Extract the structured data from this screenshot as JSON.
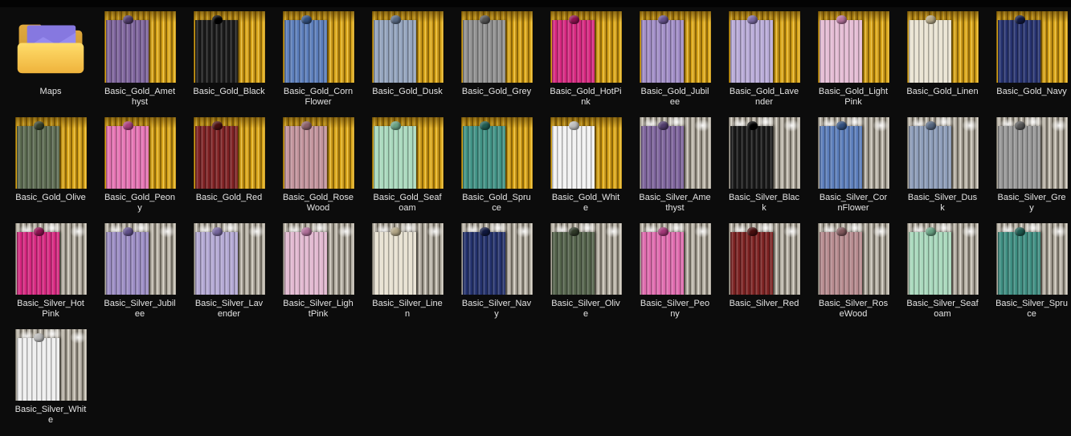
{
  "explorer": {
    "background": "#0c0c0c",
    "text_color": "#e4e4e4",
    "view": "large-icons-grid"
  },
  "folder": {
    "label": "Maps",
    "icon": "folder-with-map-icon",
    "folder_front_color": "#ffd75e",
    "folder_back_color": "#d99c2e",
    "map_color": "#8678e0"
  },
  "curtain_palette": {
    "gold_base": "#c8961a",
    "gold_light": "#f2cd55",
    "gold_dark": "#8a6508",
    "silver_base": "#aba599",
    "silver_light": "#e2ddd3",
    "silver_dark": "#6b665c"
  },
  "items": [
    {
      "label": "Basic_Gold_Amethyst",
      "curtain": "gold",
      "drape": "#7d639c",
      "accent": "#503c6b"
    },
    {
      "label": "Basic_Gold_Black",
      "curtain": "gold",
      "drape": "#191919",
      "accent": "#000000"
    },
    {
      "label": "Basic_Gold_CornFlower",
      "curtain": "gold",
      "drape": "#5a7cba",
      "accent": "#33517f"
    },
    {
      "label": "Basic_Gold_Dusk",
      "curtain": "gold",
      "drape": "#93a3bd",
      "accent": "#5a6b85"
    },
    {
      "label": "Basic_Gold_Grey",
      "curtain": "gold",
      "drape": "#909090",
      "accent": "#545454"
    },
    {
      "label": "Basic_Gold_HotPink",
      "curtain": "gold",
      "drape": "#d6267f",
      "accent": "#8e1251"
    },
    {
      "label": "Basic_Gold_Jubilee",
      "curtain": "gold",
      "drape": "#a18dc7",
      "accent": "#67538e"
    },
    {
      "label": "Basic_Gold_Lavender",
      "curtain": "gold",
      "drape": "#b9abd8",
      "accent": "#7c6ba3"
    },
    {
      "label": "Basic_Gold_LightPink",
      "curtain": "gold",
      "drape": "#e5bcd4",
      "accent": "#b5749e"
    },
    {
      "label": "Basic_Gold_Linen",
      "curtain": "gold",
      "drape": "#eae4d3",
      "accent": "#b5a887"
    },
    {
      "label": "Basic_Gold_Navy",
      "curtain": "gold",
      "drape": "#25316e",
      "accent": "#121a42"
    },
    {
      "label": "Basic_Gold_Olive",
      "curtain": "gold",
      "drape": "#5b6a50",
      "accent": "#35402c"
    },
    {
      "label": "Basic_Gold_Peony",
      "curtain": "gold",
      "drape": "#e673b3",
      "accent": "#a83f7c"
    },
    {
      "label": "Basic_Gold_Red",
      "curtain": "gold",
      "drape": "#7d2022",
      "accent": "#4a0f10"
    },
    {
      "label": "Basic_Gold_RoseWood",
      "curtain": "gold",
      "drape": "#c2939c",
      "accent": "#8a5f68"
    },
    {
      "label": "Basic_Gold_Seafoam",
      "curtain": "gold",
      "drape": "#a9d9bd",
      "accent": "#6aa284"
    },
    {
      "label": "Basic_Gold_Spruce",
      "curtain": "gold",
      "drape": "#3f9184",
      "accent": "#215c52"
    },
    {
      "label": "Basic_Gold_White",
      "curtain": "gold",
      "drape": "#f2f2f2",
      "accent": "#bdbdbd"
    },
    {
      "label": "Basic_Silver_Amethyst",
      "curtain": "silver",
      "drape": "#7d639c",
      "accent": "#503c6b"
    },
    {
      "label": "Basic_Silver_Black",
      "curtain": "silver",
      "drape": "#171717",
      "accent": "#000000"
    },
    {
      "label": "Basic_Silver_CornFlower",
      "curtain": "silver",
      "drape": "#5a7cba",
      "accent": "#33517f"
    },
    {
      "label": "Basic_Silver_Dusk",
      "curtain": "silver",
      "drape": "#8c9cb8",
      "accent": "#566780"
    },
    {
      "label": "Basic_Silver_Grey",
      "curtain": "silver",
      "drape": "#989898",
      "accent": "#585858"
    },
    {
      "label": "Basic_Silver_HotPink",
      "curtain": "silver",
      "drape": "#d6267f",
      "accent": "#8e1251"
    },
    {
      "label": "Basic_Silver_Jubilee",
      "curtain": "silver",
      "drape": "#9b8cc4",
      "accent": "#62528c"
    },
    {
      "label": "Basic_Silver_Lavender",
      "curtain": "silver",
      "drape": "#b3a8d4",
      "accent": "#77689f"
    },
    {
      "label": "Basic_Silver_LightPink",
      "curtain": "silver",
      "drape": "#e2b8d0",
      "accent": "#b0709a"
    },
    {
      "label": "Basic_Silver_Linen",
      "curtain": "silver",
      "drape": "#e8e2d2",
      "accent": "#b2a686"
    },
    {
      "label": "Basic_Silver_Navy",
      "curtain": "silver",
      "drape": "#22306b",
      "accent": "#111940"
    },
    {
      "label": "Basic_Silver_Olive",
      "curtain": "silver",
      "drape": "#53624a",
      "accent": "#303a29"
    },
    {
      "label": "Basic_Silver_Peony",
      "curtain": "silver",
      "drape": "#e06aae",
      "accent": "#a23878"
    },
    {
      "label": "Basic_Silver_Red",
      "curtain": "silver",
      "drape": "#7a2020",
      "accent": "#480f0f"
    },
    {
      "label": "Basic_Silver_RoseWood",
      "curtain": "silver",
      "drape": "#b68a8e",
      "accent": "#80585c"
    },
    {
      "label": "Basic_Silver_Seafoam",
      "curtain": "silver",
      "drape": "#a8d8bc",
      "accent": "#69a183"
    },
    {
      "label": "Basic_Silver_Spruce",
      "curtain": "silver",
      "drape": "#3d8d80",
      "accent": "#1f594f"
    },
    {
      "label": "Basic_Silver_White",
      "curtain": "silver",
      "drape": "#efefef",
      "accent": "#bababa"
    }
  ]
}
